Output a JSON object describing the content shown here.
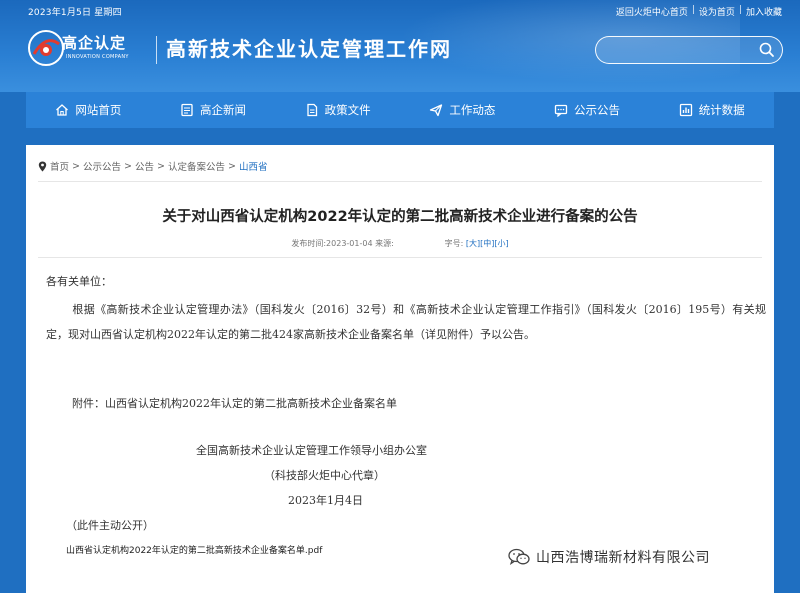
{
  "topbar": {
    "date": "2023年1月5日 星期四",
    "links": [
      "返回火炬中心首页",
      "设为首页",
      "加入收藏"
    ],
    "separator": "|"
  },
  "logo": {
    "cn": "高企认定",
    "en": "INNOVATION COMPANY"
  },
  "site_title": "高新技术企业认定管理工作网",
  "search": {
    "placeholder": ""
  },
  "nav": {
    "items": [
      {
        "label": "网站首页",
        "icon": "home-icon"
      },
      {
        "label": "高企新闻",
        "icon": "news-icon"
      },
      {
        "label": "政策文件",
        "icon": "document-icon"
      },
      {
        "label": "工作动态",
        "icon": "send-icon"
      },
      {
        "label": "公示公告",
        "icon": "notice-icon"
      },
      {
        "label": "统计数据",
        "icon": "chart-icon"
      }
    ]
  },
  "breadcrumb": {
    "items": [
      "首页",
      "公示公告",
      "公告",
      "认定备案公告"
    ],
    "separator": ">",
    "current": "山西省"
  },
  "article": {
    "title": "关于对山西省认定机构2022年认定的第二批高新技术企业进行备案的公告",
    "meta": {
      "publish_label": "发布时间:",
      "publish_date": "2023-01-04",
      "source_label": "来源:",
      "fontsize_label": "字号:",
      "sizes": [
        "[大]",
        "[中]",
        "[小]"
      ]
    },
    "salutation": "各有关单位：",
    "body": "根据《高新技术企业认定管理办法》（国科发火〔2016〕32号）和《高新技术企业认定管理工作指引》（国科发火〔2016〕195号）有关规定，现对山西省认定机构2022年认定的第二批424家高新技术企业备案名单（详见附件）予以公告。",
    "attachment": "附件：山西省认定机构2022年认定的第二批高新技术企业备案名单",
    "signature_org": "全国高新技术企业认定管理工作领导小组办公室",
    "signature_seal": "（科技部火炬中心代章）",
    "signature_date": "2023年1月4日",
    "public_note": "（此件主动公开）",
    "file_link": "山西省认定机构2022年认定的第二批高新技术企业备案名单.pdf"
  },
  "watermark": {
    "text": "山西浩博瑞新材料有限公司",
    "icon": "wechat-icon"
  },
  "colors": {
    "primary": "#1f6fc1",
    "nav": "#2b82d8"
  }
}
